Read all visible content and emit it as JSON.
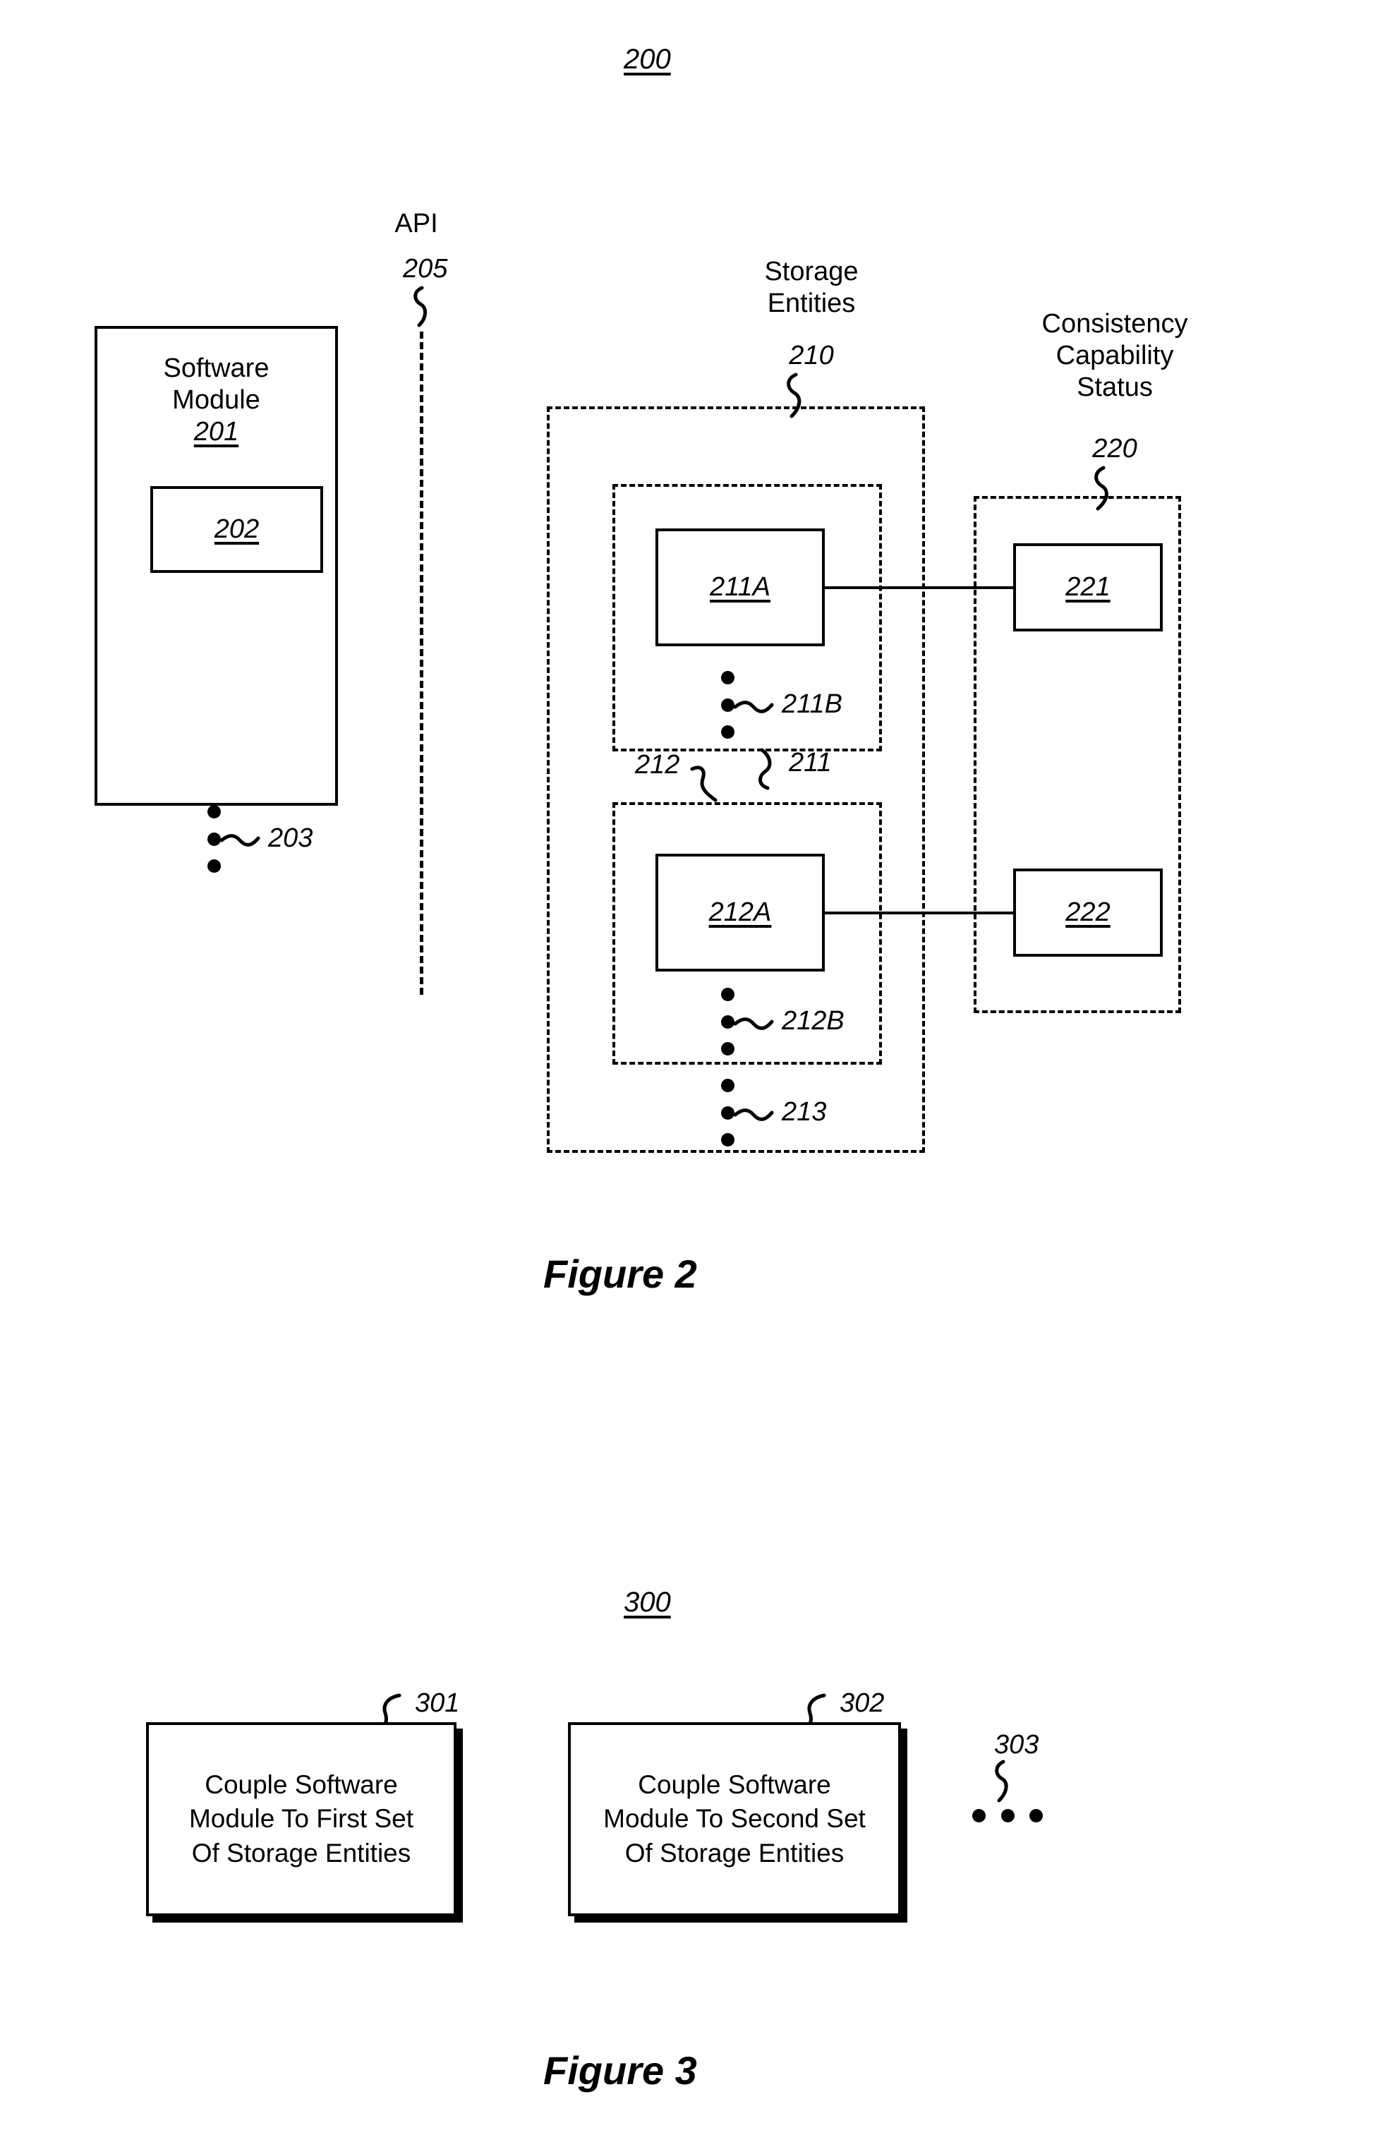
{
  "figure2": {
    "number_label": "200",
    "caption": "Figure 2",
    "software_module": {
      "title_line1": "Software",
      "title_line2": "Module",
      "ref": "201",
      "inner_box_ref": "202",
      "ellipsis_ref": "203"
    },
    "api": {
      "label": "API",
      "ref": "205"
    },
    "storage_entities": {
      "title_line1": "Storage",
      "title_line2": "Entities",
      "ref": "210",
      "group_first": {
        "ref": "211",
        "entity_ref": "211A",
        "ellipsis_ref": "211B"
      },
      "group_second": {
        "ref": "212",
        "entity_ref": "212A",
        "ellipsis_ref": "212B"
      },
      "ellipsis_ref": "213"
    },
    "consistency_capability_status": {
      "title_line1": "Consistency",
      "title_line2": "Capability",
      "title_line3": "Status",
      "ref": "220",
      "status_first_ref": "221",
      "status_second_ref": "222"
    }
  },
  "figure3": {
    "number_label": "300",
    "caption": "Figure 3",
    "steps": [
      {
        "ref": "301",
        "line1": "Couple Software",
        "line2": "Module To First Set",
        "line3": "Of Storage Entities"
      },
      {
        "ref": "302",
        "line1": "Couple Software",
        "line2": "Module To Second Set",
        "line3": "Of Storage Entities"
      }
    ],
    "ellipsis_ref": "303"
  }
}
